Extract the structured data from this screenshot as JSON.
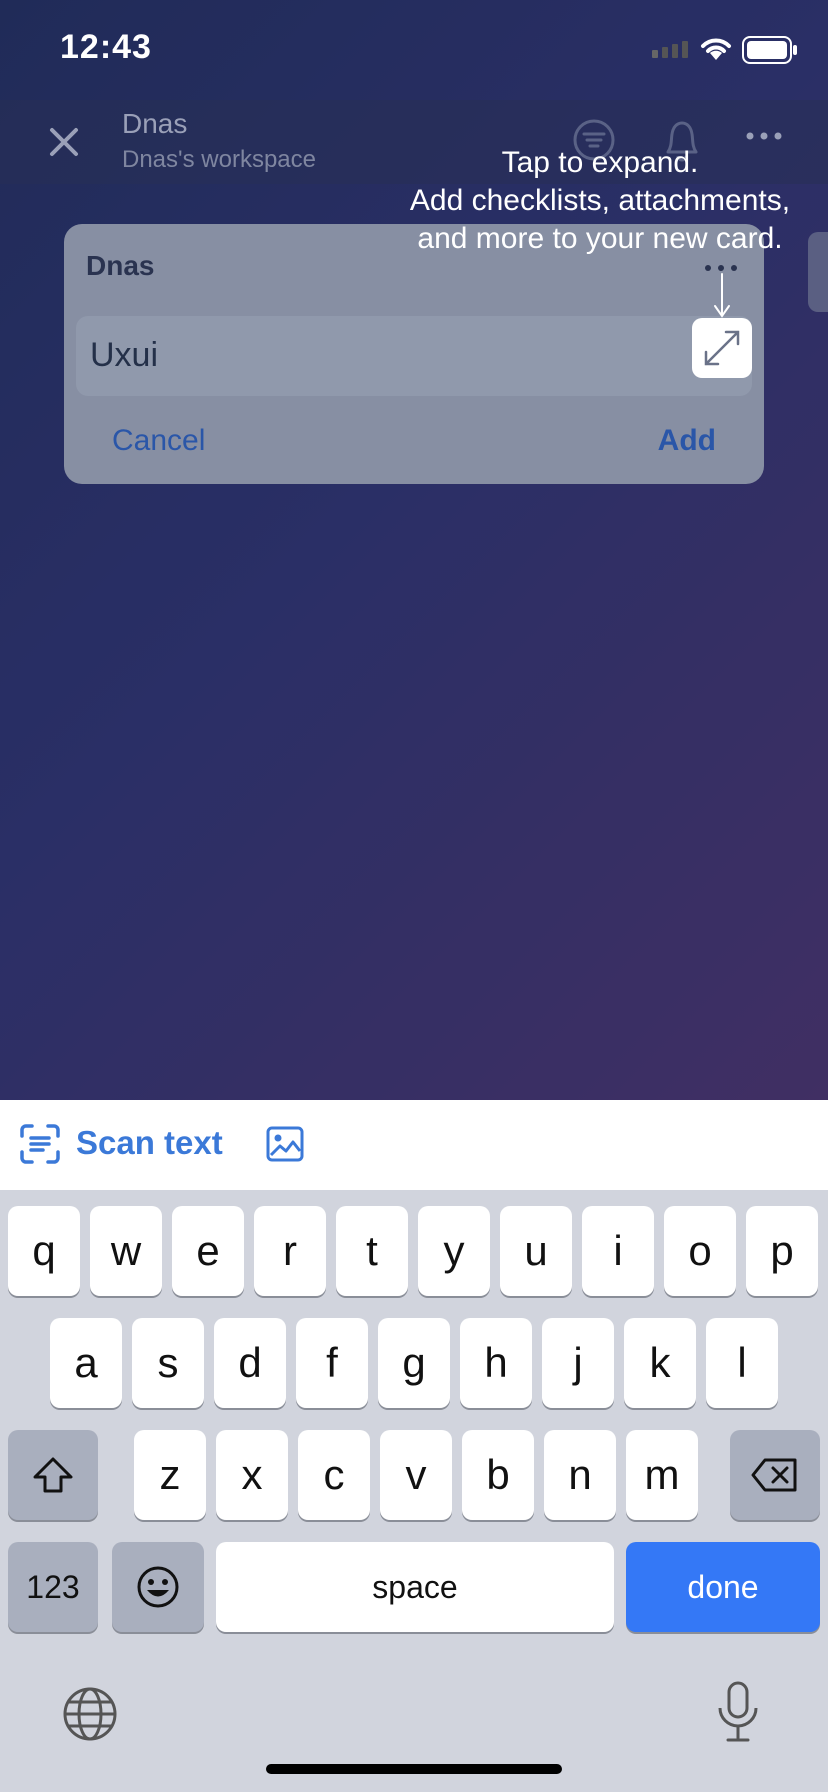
{
  "status_bar": {
    "time": "12:43"
  },
  "header": {
    "board_title": "Dnas",
    "workspace": "Dnas's workspace"
  },
  "tooltip": {
    "lines": [
      "Tap to expand.",
      "Add checklists, attachments,",
      "and more to your new card."
    ]
  },
  "card_composer": {
    "list_name": "Dnas",
    "input_value": "Uxui",
    "cancel_label": "Cancel",
    "add_label": "Add"
  },
  "toolbar": {
    "scan_text_label": "Scan text"
  },
  "keyboard": {
    "row1": [
      "q",
      "w",
      "e",
      "r",
      "t",
      "y",
      "u",
      "i",
      "o",
      "p"
    ],
    "row2": [
      "a",
      "s",
      "d",
      "f",
      "g",
      "h",
      "j",
      "k",
      "l"
    ],
    "row3": [
      "z",
      "x",
      "c",
      "v",
      "b",
      "n",
      "m"
    ],
    "numbers_label": "123",
    "space_label": "space",
    "done_label": "done"
  },
  "colors": {
    "accent_blue": "#3478f6",
    "link_blue": "#2a56a8",
    "card_bg": "#878fa3"
  },
  "icons": [
    "close-icon",
    "filter-icon",
    "bell-icon",
    "more-icon",
    "expand-icon",
    "scan-text-icon",
    "image-icon",
    "shift-icon",
    "delete-icon",
    "emoji-icon",
    "globe-icon",
    "microphone-icon"
  ]
}
